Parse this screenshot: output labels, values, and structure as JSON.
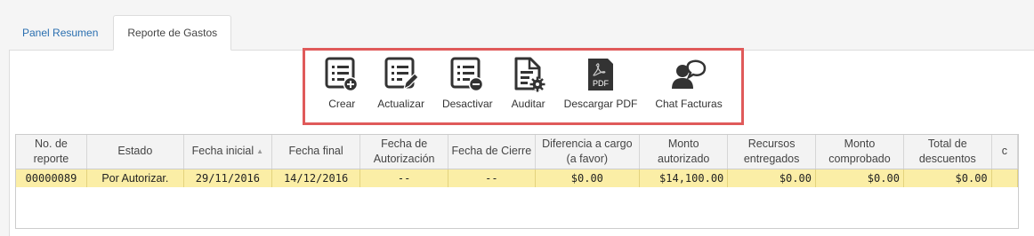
{
  "tabs": [
    {
      "label": "Panel Resumen",
      "active": false
    },
    {
      "label": "Reporte de Gastos",
      "active": true
    }
  ],
  "toolbar": {
    "highlight_color": "#e05a5a",
    "actions": [
      {
        "label": "Crear",
        "icon": "list-add-icon"
      },
      {
        "label": "Actualizar",
        "icon": "list-edit-icon"
      },
      {
        "label": "Desactivar",
        "icon": "list-remove-icon"
      },
      {
        "label": "Auditar",
        "icon": "document-gear-icon"
      },
      {
        "label": "Descargar PDF",
        "icon": "pdf-icon"
      },
      {
        "label": "Chat Facturas",
        "icon": "chat-user-icon"
      }
    ]
  },
  "table": {
    "columns": [
      "No. de reporte",
      "Estado",
      "Fecha inicial",
      "Fecha final",
      "Fecha de Autorización",
      "Fecha de Cierre",
      "Diferencia a cargo (a favor)",
      "Monto autorizado",
      "Recursos entregados",
      "Monto comprobado",
      "Total de descuentos",
      "c"
    ],
    "rows": [
      [
        "00000089",
        "Por Autorizar.",
        "29/11/2016",
        "14/12/2016",
        "--",
        "--",
        "$0.00",
        "$14,100.00",
        "$0.00",
        "$0.00",
        "$0.00",
        ""
      ]
    ],
    "selected_row_color": "#fbeea6"
  }
}
